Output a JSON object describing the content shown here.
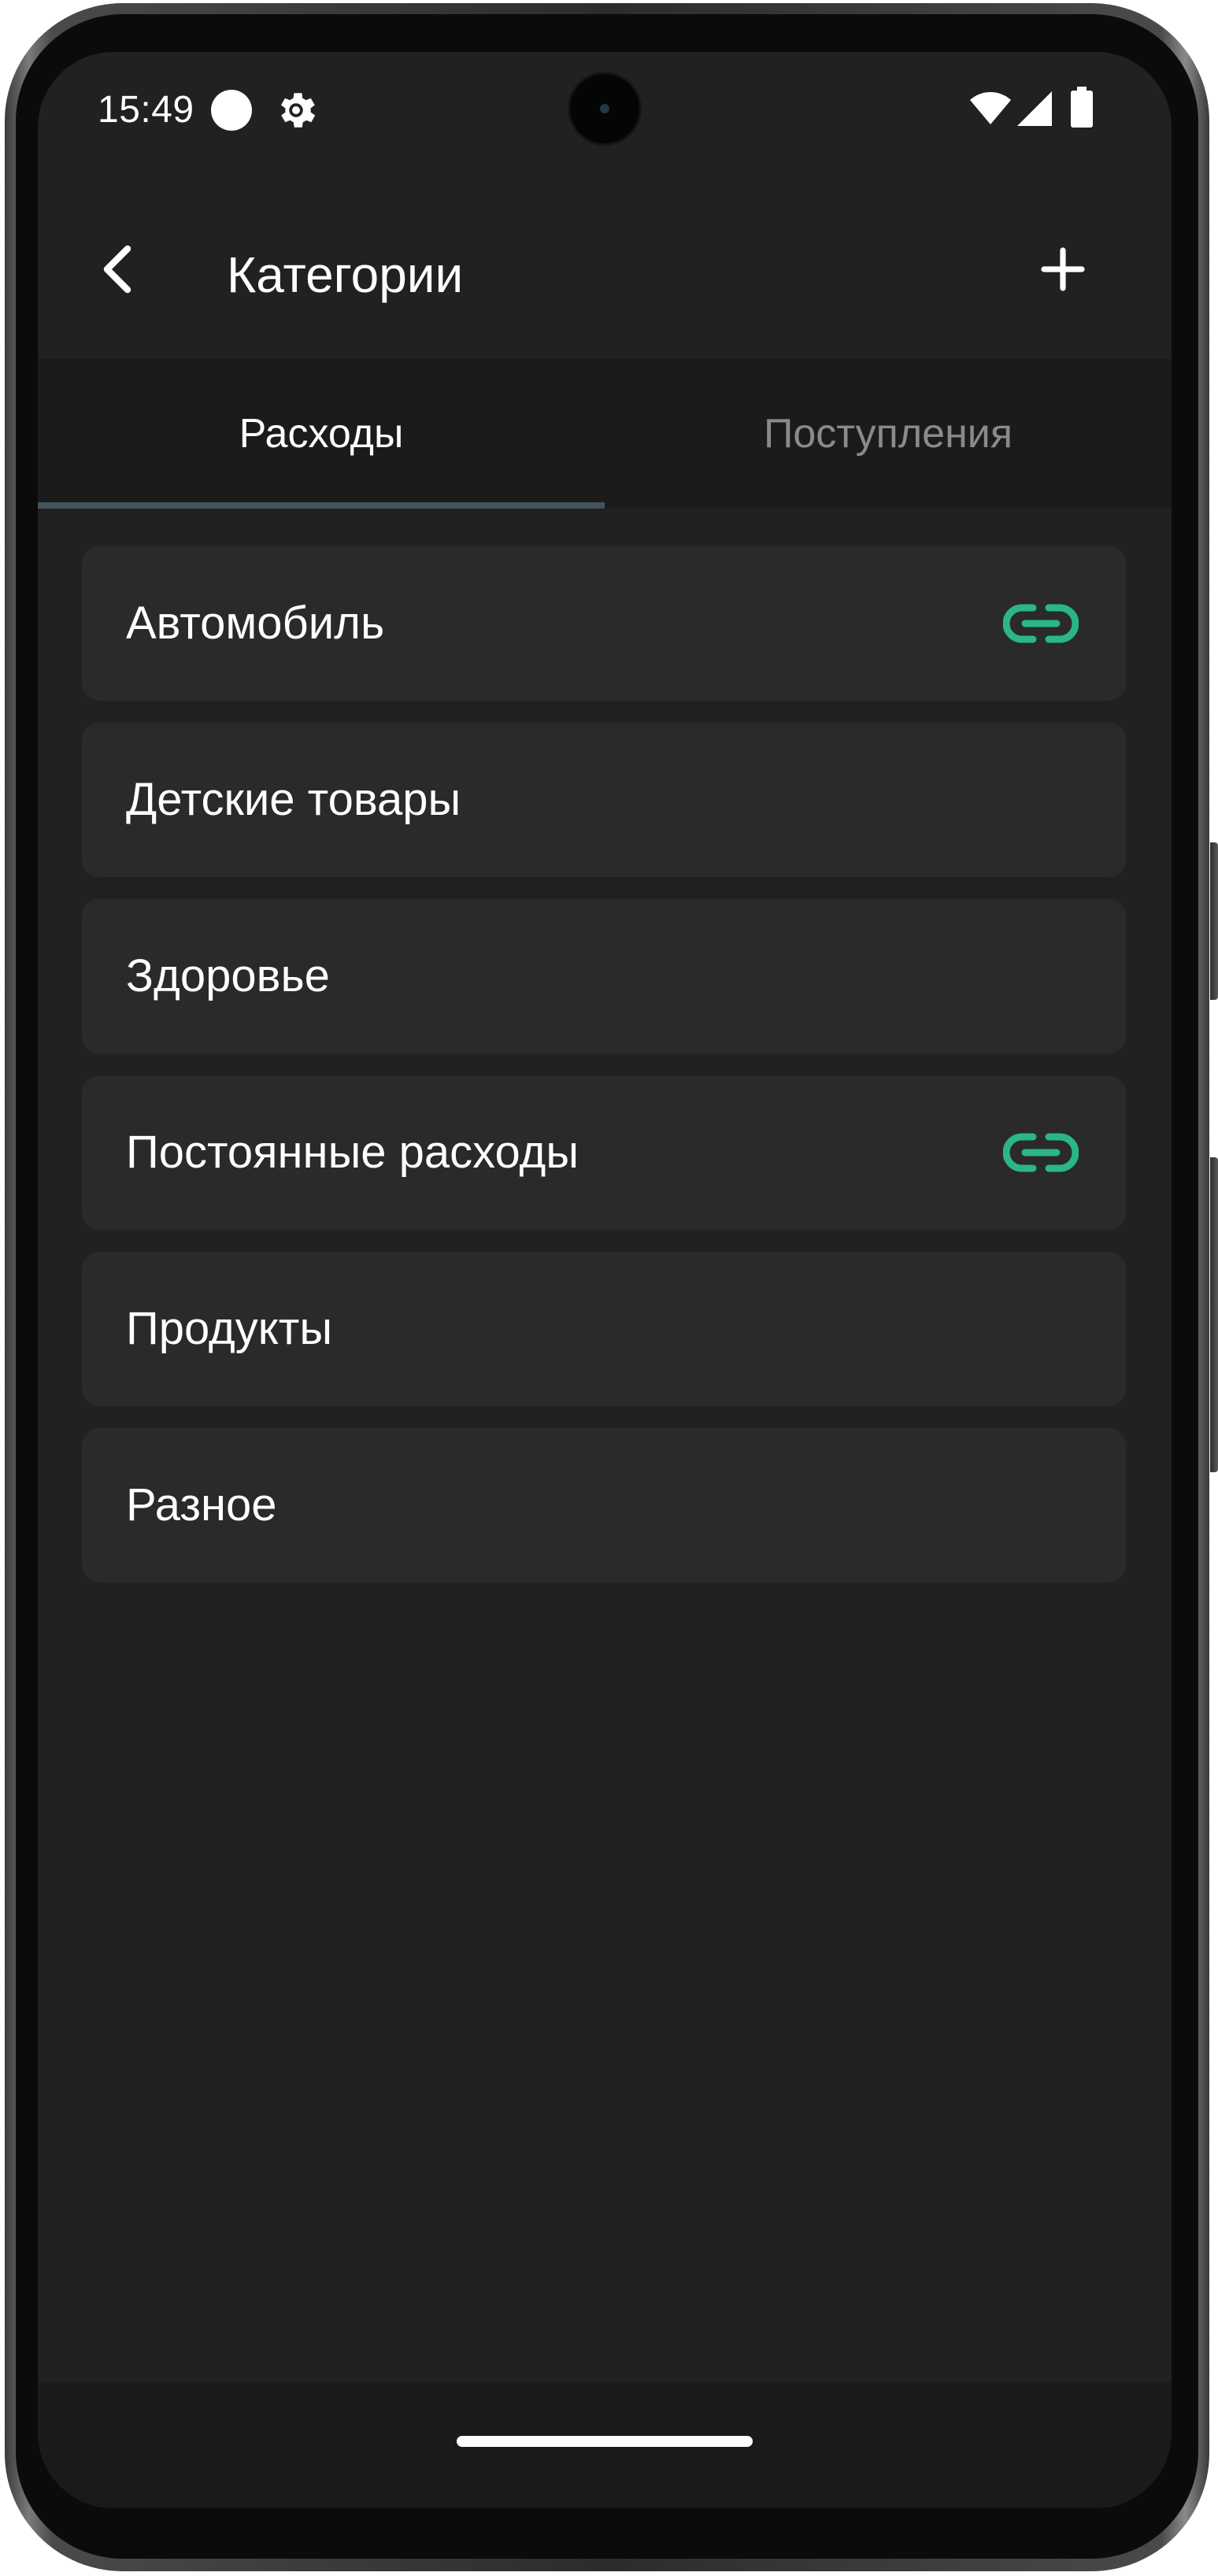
{
  "status_bar": {
    "time": "15:49",
    "icons": [
      "circle-notification-icon",
      "gear-icon",
      "wifi-icon",
      "signal-icon",
      "battery-icon"
    ]
  },
  "app_bar": {
    "title": "Категории",
    "back_icon": "chevron-left-icon",
    "add_icon": "plus-icon"
  },
  "tabs": [
    {
      "label": "Расходы",
      "selected": true
    },
    {
      "label": "Поступления",
      "selected": false
    }
  ],
  "categories": [
    {
      "label": "Автомобиль",
      "linked": true
    },
    {
      "label": "Детские товары",
      "linked": false
    },
    {
      "label": "Здоровье",
      "linked": false
    },
    {
      "label": "Постоянные расходы",
      "linked": true
    },
    {
      "label": "Продукты",
      "linked": false
    },
    {
      "label": "Разное",
      "linked": false
    }
  ],
  "colors": {
    "background": "#212121",
    "card": "#2a2a2a",
    "accent_link": "#2bb58a",
    "tab_indicator": "#44525c",
    "inactive_tab": "#8a8a8a"
  }
}
